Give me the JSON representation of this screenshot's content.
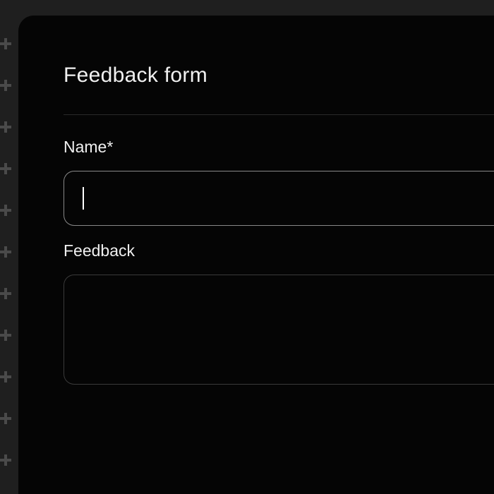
{
  "form": {
    "title": "Feedback form",
    "fields": {
      "name": {
        "label": "Name*",
        "value": ""
      },
      "feedback": {
        "label": "Feedback",
        "value": ""
      }
    }
  }
}
